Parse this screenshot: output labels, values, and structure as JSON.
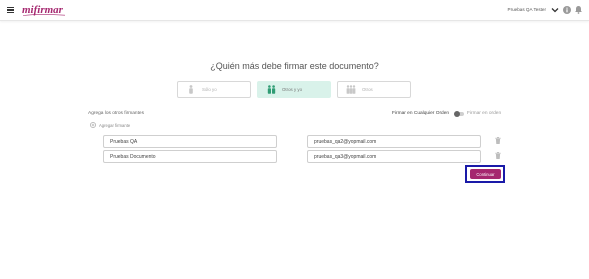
{
  "header": {
    "logo_text": "mifirmar",
    "user_name": "Pruebas QA Tester",
    "icons": [
      "menu-icon",
      "chevron-down-icon",
      "info-icon",
      "bell-icon"
    ]
  },
  "main": {
    "question": "¿Quién más debe firmar este documento?",
    "options": [
      {
        "label": "Sólo yo",
        "icon": "person-icon",
        "selected": false
      },
      {
        "label": "Otros y yo",
        "icon": "people-icon",
        "selected": true
      },
      {
        "label": "Otros",
        "icon": "group-icon",
        "selected": false
      }
    ],
    "add_signers_label": "Agrega los otros firmantes",
    "add_signer_link": "Agregar firmante",
    "order": {
      "any_order_label": "Firmar en Cualquier Orden",
      "in_order_label": "Firmar en orden",
      "in_order_enabled": false
    },
    "signers": [
      {
        "name": "Pruebas QA",
        "email": "pruebas_qa2@yopmail.com"
      },
      {
        "name": "Pruebas Documento",
        "email": "pruebas_qa3@yopmail.com"
      }
    ],
    "continue_label": "Continuar"
  },
  "colors": {
    "brand": "#a5276f",
    "selected_option_bg": "#d9f2ea",
    "highlight_border": "#1a1aa8"
  }
}
